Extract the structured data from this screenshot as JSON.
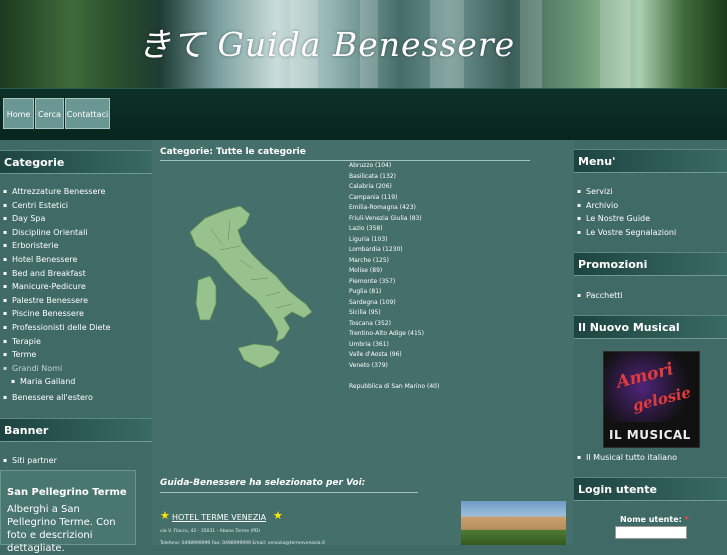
{
  "header": {
    "title": "きて  Guida Benessere"
  },
  "nav": {
    "items": [
      "Home",
      "Cerca",
      "Contattaci"
    ]
  },
  "left": {
    "categories_title": "Categorie",
    "categories": [
      "Attrezzature Benessere",
      "Centri Estetici",
      "Day Spa",
      "Discipline Orientali",
      "Erboristerie",
      "Hotel Benessere",
      "Bed and Breakfast",
      "Manicure-Pedicure",
      "Palestre Benessere",
      "Piscine Benessere",
      "Professionisti delle Diete",
      "Terapie",
      "Terme",
      "Grandi Nomi",
      "Maria Galland",
      "Benessere all'estero"
    ],
    "banner_title": "Banner",
    "banner_items": [
      "Siti partner"
    ],
    "promo": {
      "title": "San Pellegrino Terme",
      "text": "Alberghi a San Pellegrino Terme. Con foto e descrizioni dettagliate."
    }
  },
  "center": {
    "categories_heading": "Categorie: Tutte le categorie",
    "regions": [
      "Abruzzo (104)",
      "Basilicata (132)",
      "Calabria (206)",
      "Campania (119)",
      "Emilia-Romagna (423)",
      "Friuli-Venezia Giulia (83)",
      "Lazio (358)",
      "Liguria (103)",
      "Lombardia (1230)",
      "Marche (125)",
      "Molise (89)",
      "Piemonte (357)",
      "Puglia (81)",
      "Sardegna (109)",
      "Sicilia (95)",
      "Toscana (352)",
      "Trentino-Alto Adige (415)",
      "Umbria (361)",
      "Valle d'Aosta (96)",
      "Veneto (379)",
      "",
      "Repubblica di San Marino (40)"
    ],
    "selection_heading": "Guida-Benessere ha selezionato per Voi:",
    "hotel": {
      "name": "HOTEL TERME VENEZIA",
      "address": "via V. Flacco, 42 - 35031 - Abano Terme (PD)",
      "phone": "Telefono: 0498999999 Fax: 0498999999 Email: venezia@termevenezia.it"
    }
  },
  "right": {
    "menu_title": "Menu'",
    "menu": [
      "Servizi",
      "Archivio",
      "Le Nostre Guide",
      "Le Vostre Segnalazioni"
    ],
    "promozioni_title": "Promozioni",
    "promozioni": [
      "Pacchetti"
    ],
    "musical_title": "Il Nuovo Musical",
    "musical_image": {
      "line1": "Amori",
      "line2": "gelosie",
      "line3": "IL MUSICAL"
    },
    "musical_link": "Il Musical tutto italiano",
    "login_title": "Login utente",
    "username_label": "Nome utente:",
    "required_mark": "*"
  },
  "colors": {
    "panel": "#3f6a66",
    "center": "#456f6b",
    "navbar": "#0c3026",
    "accent_star": "#ffe600"
  }
}
